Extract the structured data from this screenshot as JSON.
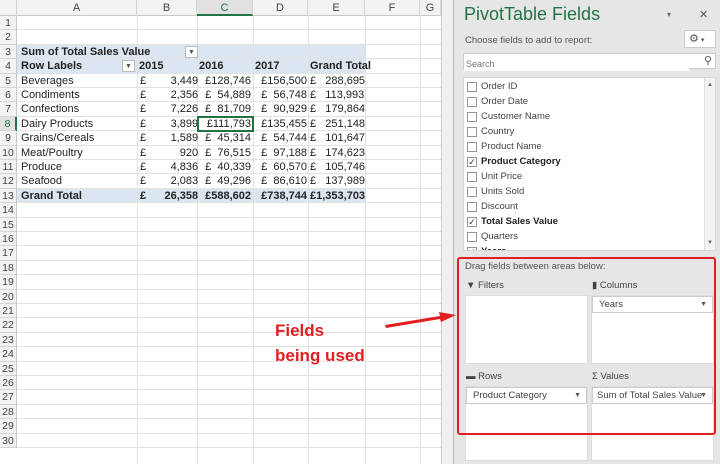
{
  "sheet": {
    "columns": [
      "A",
      "B",
      "C",
      "D",
      "E",
      "F",
      "G"
    ],
    "selected_column": "C",
    "selected_row": 8,
    "row_count": 30,
    "pivot": {
      "title": "Sum of Total Sales Value",
      "row_labels_header": "Row Labels",
      "year_headers": [
        "2015",
        "2016",
        "2017",
        "Grand Total"
      ],
      "rows": [
        {
          "label": "Beverages",
          "values": [
            "£        3,449",
            "£128,746",
            "£156,500",
            "£   288,695"
          ]
        },
        {
          "label": "Condiments",
          "values": [
            "£        2,356",
            "£  54,889",
            "£  56,748",
            "£   113,993"
          ]
        },
        {
          "label": "Confections",
          "values": [
            "£        7,226",
            "£  81,709",
            "£  90,929",
            "£   179,864"
          ]
        },
        {
          "label": "Dairy Products",
          "values": [
            "£        3,899",
            "£111,793",
            "£135,455",
            "£   251,148"
          ]
        },
        {
          "label": "Grains/Cereals",
          "values": [
            "£        1,589",
            "£  45,314",
            "£  54,744",
            "£   101,647"
          ]
        },
        {
          "label": "Meat/Poultry",
          "values": [
            "£           920",
            "£  76,515",
            "£  97,188",
            "£   174,623"
          ]
        },
        {
          "label": "Produce",
          "values": [
            "£        4,836",
            "£  40,339",
            "£  60,570",
            "£   105,746"
          ]
        },
        {
          "label": "Seafood",
          "values": [
            "£        2,083",
            "£  49,296",
            "£  86,610",
            "£   137,989"
          ]
        }
      ],
      "grand_total": {
        "label": "Grand Total",
        "values": [
          "£      26,358",
          "£588,602",
          "£738,744",
          "£1,353,703"
        ]
      }
    }
  },
  "pane": {
    "title": "PivotTable Fields",
    "choose_label": "Choose fields to add to report:",
    "search_placeholder": "Search",
    "fields": [
      {
        "name": "Order ID",
        "checked": false
      },
      {
        "name": "Order Date",
        "checked": false
      },
      {
        "name": "Customer Name",
        "checked": false
      },
      {
        "name": "Country",
        "checked": false
      },
      {
        "name": "Product Name",
        "checked": false
      },
      {
        "name": "Product Category",
        "checked": true
      },
      {
        "name": "Unit Price",
        "checked": false
      },
      {
        "name": "Units Sold",
        "checked": false
      },
      {
        "name": "Discount",
        "checked": false
      },
      {
        "name": "Total Sales Value",
        "checked": true
      },
      {
        "name": "Quarters",
        "checked": false
      },
      {
        "name": "Years",
        "checked": true
      }
    ],
    "drag_label": "Drag fields between areas below:",
    "areas": {
      "filters": {
        "label": "Filters"
      },
      "columns": {
        "label": "Columns",
        "item": "Years"
      },
      "rows": {
        "label": "Rows",
        "item": "Product Category"
      },
      "values": {
        "label": "Values",
        "item": "Sum of Total Sales Value"
      }
    }
  },
  "annotation": {
    "line1": "Fields",
    "line2": "being used",
    "color": "#e02020"
  },
  "colors": {
    "accent": "#217346",
    "pivot_band": "#dce6f1"
  }
}
